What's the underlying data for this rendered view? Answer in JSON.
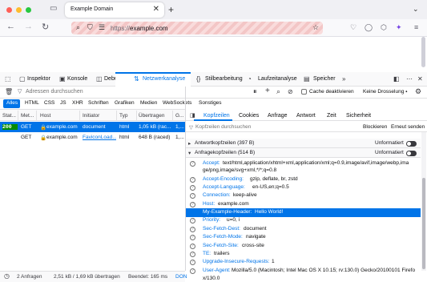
{
  "browser": {
    "tab_title": "Example Domain",
    "tab_close": "✕",
    "new_tab": "+",
    "url_scheme": "https://",
    "url_host": "example.com"
  },
  "devtools": {
    "tabs": [
      {
        "label": "Inspektor"
      },
      {
        "label": "Konsole"
      },
      {
        "label": "Debugger"
      },
      {
        "label": "Netzwerkanalyse"
      },
      {
        "label": "Stilbearbeitung"
      },
      {
        "label": "Laufzeitanalyse"
      },
      {
        "label": "Speicher"
      }
    ],
    "url_filter_placeholder": "Adressen durchsuchen",
    "disable_cache_label": "Cache deaktivieren",
    "throttling_label": "Keine Drosselung ⬩",
    "type_filters": [
      "Alles",
      "HTML",
      "CSS",
      "JS",
      "XHR",
      "Schriften",
      "Grafiken",
      "Medien",
      "WebSockets",
      "Sonstiges"
    ],
    "columns": [
      "Stat...",
      "Met...",
      "Host",
      "Initiator",
      "Typ",
      "Übertragen",
      "G..."
    ],
    "requests": [
      {
        "status": "200",
        "method": "GET",
        "host": "example.com",
        "initiator": "document",
        "type": "html",
        "transferred": "1,05 kB (rac...",
        "size": "1,..."
      },
      {
        "status": "",
        "method": "GET",
        "host": "example.com",
        "initiator": "FaviconLoad...",
        "type": "html",
        "transferred": "648 B (raced)",
        "size": "1,..."
      }
    ],
    "detail_tabs": [
      "Kopfzeilen",
      "Cookies",
      "Anfrage",
      "Antwort",
      "Zeit",
      "Sicherheit"
    ],
    "header_filter_placeholder": "Kopfzeilen durchsuchen",
    "block_label": "Blockieren",
    "resend_label": "Erneut senden",
    "response_section": "Antwortkopfzeilen (397 B)",
    "request_section": "Anfragekopfzeilen (514 B)",
    "raw_label": "Unformatiert",
    "request_headers": [
      {
        "name": "Accept:",
        "value": "text/html,application/xhtml+xml,application/xml;q=0.9,image/avif,image/webp,ima"
      },
      {
        "name": "",
        "value": "ge/png,image/svg+xml,*/*;q=0.8"
      },
      {
        "name": "Accept-Encoding:",
        "value": "gzip, deflate, br, zstd"
      },
      {
        "name": "Accept-Language:",
        "value": "en-US,en;q=0.5"
      },
      {
        "name": "Connection:",
        "value": "keep-alive"
      },
      {
        "name": "Host:",
        "value": "example.com"
      },
      {
        "name": "My-Example-Header:",
        "value": "Hello World!"
      },
      {
        "name": "Priority:",
        "value": "u=0, i"
      },
      {
        "name": "Sec-Fetch-Dest:",
        "value": "document"
      },
      {
        "name": "Sec-Fetch-Mode:",
        "value": "navigate"
      },
      {
        "name": "Sec-Fetch-Site:",
        "value": "cross-site"
      },
      {
        "name": "TE:",
        "value": "trailers"
      },
      {
        "name": "Upgrade-Insecure-Requests:",
        "value": "1"
      },
      {
        "name": "User-Agent:",
        "value": "Mozilla/5.0 (Macintosh; Intel Mac OS X 10.15; rv:130.0) Gecko/20100101 Firefo"
      },
      {
        "name": "",
        "value": "x/130.0"
      }
    ],
    "status": {
      "requests": "2 Anfragen",
      "transferred": "2,51 kB / 1,69 kB übertragen",
      "finished": "Beendet: 165 ms",
      "dom": "DON"
    }
  },
  "colors": {
    "accent": "#0074e8",
    "status_ok": "#058b00",
    "url_bg": "#f3c6c6"
  }
}
